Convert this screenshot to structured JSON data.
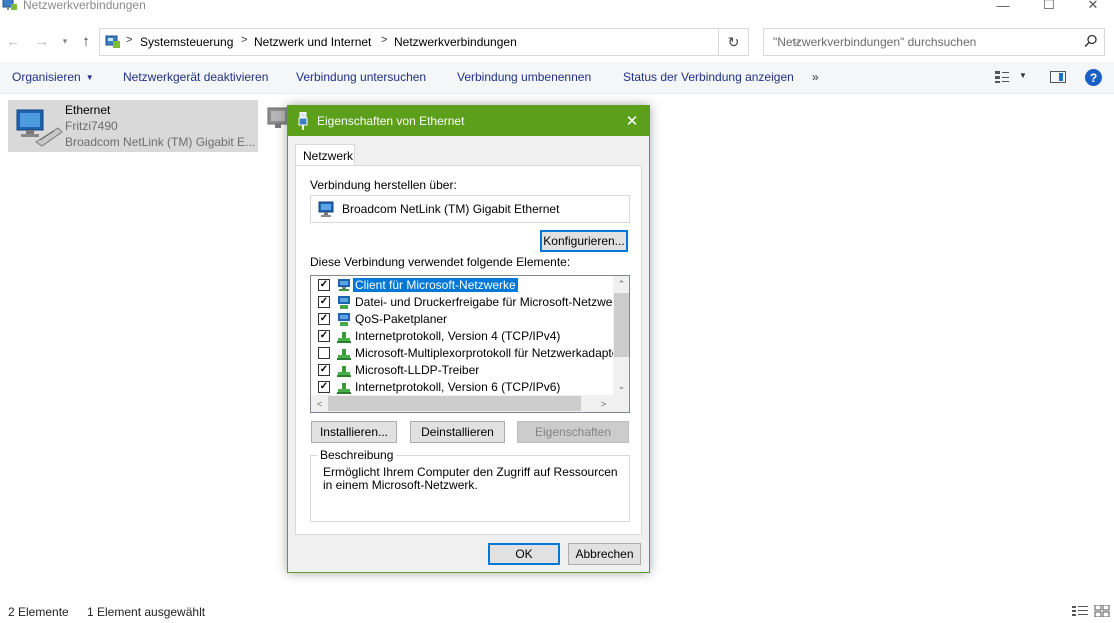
{
  "window": {
    "title": "Netzwerkverbindungen",
    "min_glyph": "—",
    "max_glyph": "☐",
    "close_glyph": "✕"
  },
  "address": {
    "crumbs": [
      "Systemsteuerung",
      "Netzwerk und Internet",
      "Netzwerkverbindungen"
    ],
    "separator": ">",
    "search_placeholder": "\"Netzwerkverbindungen\" durchsuchen"
  },
  "commands": {
    "organize": "Organisieren",
    "deactivate": "Netzwerkgerät deaktivieren",
    "diagnose": "Verbindung untersuchen",
    "rename": "Verbindung umbenennen",
    "status": "Status der Verbindung anzeigen",
    "more": "»"
  },
  "items": [
    {
      "name": "Ethernet",
      "network": "Fritzi7490",
      "device": "Broadcom NetLink (TM) Gigabit E..."
    }
  ],
  "dialog": {
    "title": "Eigenschaften von Ethernet",
    "tab": "Netzwerk",
    "connect_label": "Verbindung herstellen über:",
    "adapter": "Broadcom NetLink (TM) Gigabit Ethernet",
    "configure_button": "Konfigurieren...",
    "elements_label": "Diese Verbindung verwendet folgende Elemente:",
    "elements": [
      {
        "label": "Client für Microsoft-Netzwerke",
        "checked": true,
        "selected": true,
        "icon": "network-client-icon"
      },
      {
        "label": "Datei- und Druckerfreigabe für Microsoft-Netzwerke",
        "checked": true,
        "selected": false,
        "icon": "network-service-icon"
      },
      {
        "label": "QoS-Paketplaner",
        "checked": true,
        "selected": false,
        "icon": "network-service-icon"
      },
      {
        "label": "Internetprotokoll, Version 4 (TCP/IPv4)",
        "checked": true,
        "selected": false,
        "icon": "protocol-icon"
      },
      {
        "label": "Microsoft-Multiplexorprotokoll für Netzwerkadapter",
        "checked": false,
        "selected": false,
        "icon": "protocol-icon"
      },
      {
        "label": "Microsoft-LLDP-Treiber",
        "checked": true,
        "selected": false,
        "icon": "protocol-icon"
      },
      {
        "label": "Internetprotokoll, Version 6 (TCP/IPv6)",
        "checked": true,
        "selected": false,
        "icon": "protocol-icon"
      }
    ],
    "install_button": "Installieren...",
    "uninstall_button": "Deinstallieren",
    "properties_button": "Eigenschaften",
    "description_title": "Beschreibung",
    "description_text": "Ermöglicht Ihrem Computer den Zugriff auf Ressourcen in einem Microsoft-Netzwerk.",
    "ok_button": "OK",
    "cancel_button": "Abbrechen"
  },
  "statusbar": {
    "count": "2 Elemente",
    "selection": "1 Element ausgewählt"
  },
  "colors": {
    "dialog_title": "#5b9f1b",
    "selection": "#0078d7",
    "command_text": "#1e3287"
  }
}
